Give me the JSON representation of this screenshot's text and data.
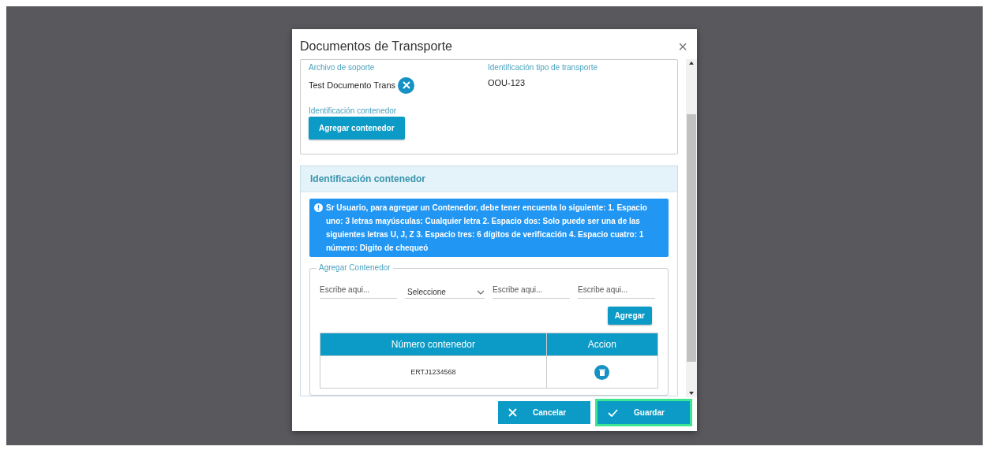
{
  "dialog": {
    "title": "Documentos de Transporte",
    "close": "×"
  },
  "document_card": {
    "fields": [
      {
        "label": "Archivo de soporte",
        "value": "Test Documento Trans",
        "removable": true
      },
      {
        "label": "Identificación tipo de transporte",
        "value": "OOU-123",
        "removable": false
      }
    ],
    "container_label": "Identificación contenedor",
    "add_button": "Agregar contenedor"
  },
  "container_panel": {
    "title": "Identificación contenedor",
    "info": "Sr Usuario, para agregar un Contenedor, debe tener encuenta lo siguiente: 1. Espacio uno: 3 letras mayúsculas: Cualquier letra 2. Espacio dos: Solo puede ser una de las siguientes letras U, J, Z 3. Espacio tres: 6 dígitos de verificación 4. Espacio cuatro: 1 número: Digito de chequeó",
    "fieldset": {
      "legend": "Agregar Contenedor",
      "inputs": [
        {
          "kind": "text",
          "placeholder": "Escribe aqui..."
        },
        {
          "kind": "select",
          "value": "Seleccione"
        },
        {
          "kind": "text",
          "placeholder": "Escribe aqui..."
        },
        {
          "kind": "text",
          "placeholder": "Escribe aqui..."
        }
      ],
      "add_button": "Agregar",
      "table": {
        "columns": [
          "Número contenedor",
          "Accion"
        ],
        "rows": [
          {
            "number": "ERTJ1234568"
          }
        ]
      }
    }
  },
  "footer": {
    "buttons": [
      {
        "kind": "cancel",
        "label": "Cancelar",
        "highlighted": false
      },
      {
        "kind": "save",
        "label": "Guardar",
        "highlighted": true
      }
    ]
  }
}
